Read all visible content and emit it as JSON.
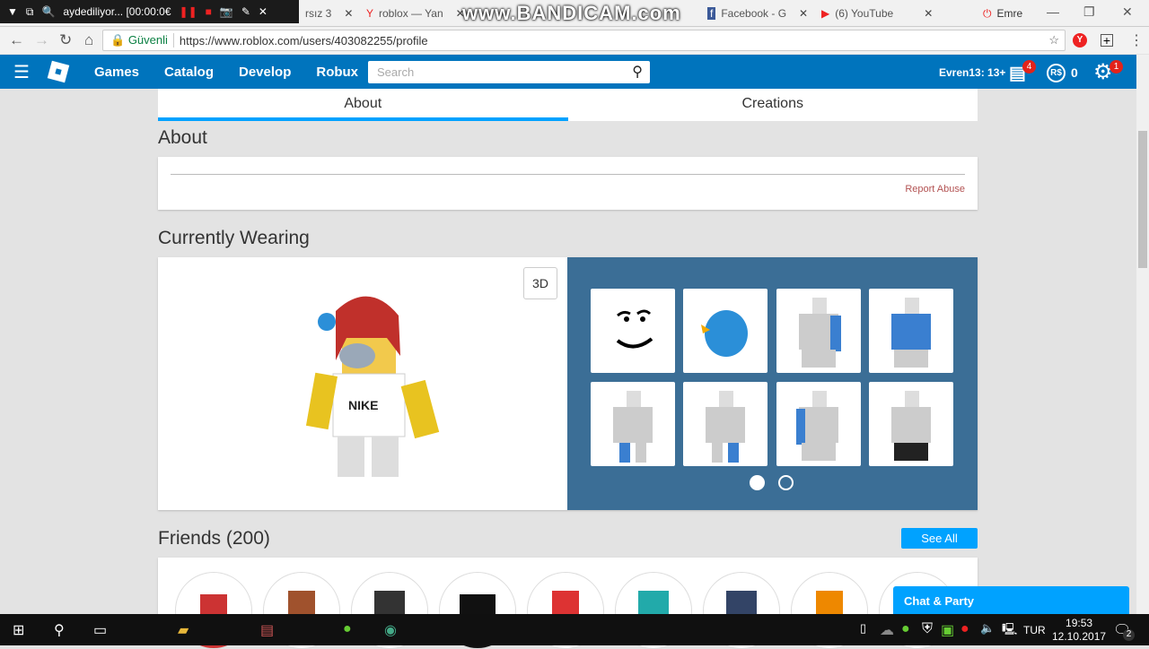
{
  "recorder": {
    "title": "aydediliyor... [00:00:0€"
  },
  "watermark": "www.BANDICAM.com",
  "tabs": [
    {
      "title": "rsız 3"
    },
    {
      "title": "roblox — Yan"
    },
    {
      "title": "Facebook - G"
    },
    {
      "title": "(6) YouTube"
    }
  ],
  "profile_name": "Emre",
  "address": {
    "security": "Güvenli",
    "url": "https://www.roblox.com/users/403082255/profile"
  },
  "header": {
    "nav": [
      "Games",
      "Catalog",
      "Develop",
      "Robux"
    ],
    "search_placeholder": "Search",
    "user": "Evren13: 13+",
    "messages_badge": "4",
    "robux": "0",
    "settings_badge": "1",
    "accent": "#0074bd"
  },
  "profile_tabs": {
    "about": "About",
    "creations": "Creations"
  },
  "about": {
    "heading": "About",
    "report": "Report Abuse"
  },
  "wearing": {
    "heading": "Currently Wearing",
    "btn_3d": "3D",
    "page": 1,
    "pages": 2
  },
  "friends": {
    "heading": "Friends (200)",
    "see_all": "See All"
  },
  "chat": {
    "label": "Chat & Party"
  },
  "taskbar": {
    "lang": "TUR",
    "time": "19:53",
    "date": "12.10.2017",
    "notifications": "2"
  }
}
